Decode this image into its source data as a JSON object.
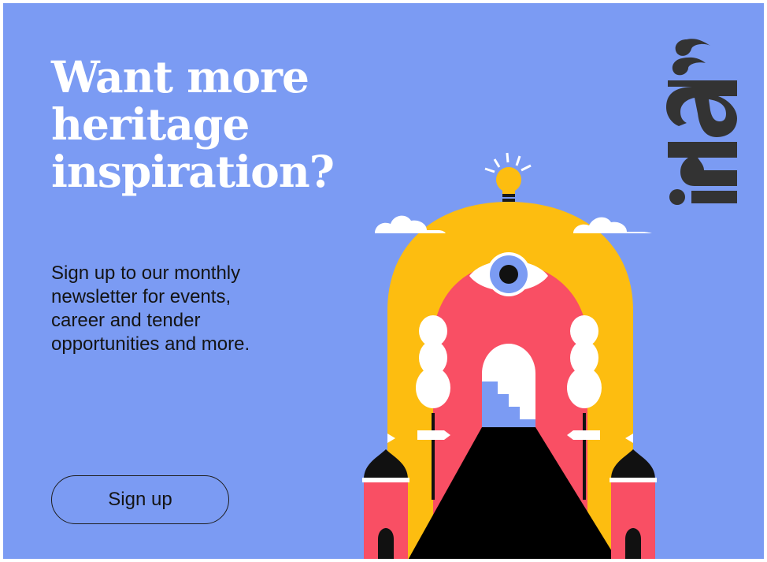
{
  "headline": {
    "line1": "Want more",
    "line2": "heritage",
    "line3": "inspiration?"
  },
  "body": {
    "line1": "Sign up to our monthly",
    "line2": "newsletter for events,",
    "line3": "career and tender",
    "line4": "opportunities and more."
  },
  "cta": {
    "label": "Sign up"
  },
  "logo": {
    "text": "ahi"
  },
  "colors": {
    "background": "#7b9bf3",
    "arch_yellow": "#fdbd10",
    "tower_red": "#f94f64",
    "logo_dark": "#333333",
    "heading": "#ffffff"
  },
  "icons": {
    "logo": "ahi-logo",
    "illustration": "heritage-building-illustration"
  }
}
